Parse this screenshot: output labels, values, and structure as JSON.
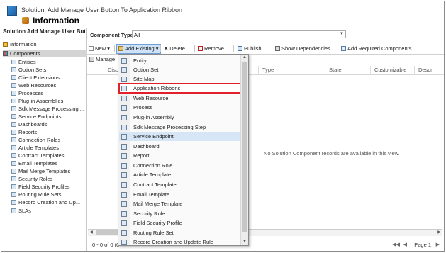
{
  "header": {
    "solution_label": "Solution: Add Manage User Button To Application Ribbon",
    "page_title": "Information"
  },
  "sidebar": {
    "title": "Solution Add Manage User Butto...",
    "items": [
      {
        "label": "Information",
        "icon": "info-icon"
      },
      {
        "label": "Components",
        "icon": "components-icon"
      },
      {
        "label": "Entities",
        "icon": "entities-icon"
      },
      {
        "label": "Option Sets",
        "icon": "option-sets-icon"
      },
      {
        "label": "Client Extensions",
        "icon": "client-extensions-icon"
      },
      {
        "label": "Web Resources",
        "icon": "web-resources-icon"
      },
      {
        "label": "Processes",
        "icon": "processes-icon"
      },
      {
        "label": "Plug-in Assemblies",
        "icon": "plugin-assemblies-icon"
      },
      {
        "label": "Sdk Message Processing ...",
        "icon": "sdk-message-icon"
      },
      {
        "label": "Service Endpoints",
        "icon": "service-endpoints-icon"
      },
      {
        "label": "Dashboards",
        "icon": "dashboards-icon"
      },
      {
        "label": "Reports",
        "icon": "reports-icon"
      },
      {
        "label": "Connection Roles",
        "icon": "connection-roles-icon"
      },
      {
        "label": "Article Templates",
        "icon": "article-templates-icon"
      },
      {
        "label": "Contract Templates",
        "icon": "contract-templates-icon"
      },
      {
        "label": "Email Templates",
        "icon": "email-templates-icon"
      },
      {
        "label": "Mail Merge Templates",
        "icon": "mail-merge-icon"
      },
      {
        "label": "Security Roles",
        "icon": "security-roles-icon"
      },
      {
        "label": "Field Security Profiles",
        "icon": "field-security-icon"
      },
      {
        "label": "Routing Rule Sets",
        "icon": "routing-rule-icon"
      },
      {
        "label": "Record Creation and Up...",
        "icon": "record-creation-icon"
      },
      {
        "label": "SLAs",
        "icon": "slas-icon"
      }
    ]
  },
  "main": {
    "component_type_label": "Component Type",
    "component_type_value": "All",
    "toolbar": {
      "new_label": "New",
      "add_existing_label": "Add Existing",
      "delete_label": "Delete",
      "remove_label": "Remove",
      "publish_label": "Publish",
      "show_dependencies_label": "Show Dependencies",
      "add_required_label": "Add Required Components"
    },
    "manage_label": "Manage",
    "columns": [
      "Disp",
      "Type",
      "State",
      "Customizable",
      "Descr"
    ],
    "empty_message": "No Solution Component records are available in this view.",
    "record_count": "0 - 0 of 0 (0",
    "page_label": "Page 1"
  },
  "dropdown_menu": {
    "items": [
      {
        "label": "Entity",
        "icon": "entity-icon"
      },
      {
        "label": "Option Set",
        "icon": "option-set-icon"
      },
      {
        "label": "Site Map",
        "icon": "site-map-icon"
      },
      {
        "label": "Application Ribbons",
        "icon": "application-ribbons-icon"
      },
      {
        "label": "Web Resource",
        "icon": "web-resource-icon"
      },
      {
        "label": "Process",
        "icon": "process-icon"
      },
      {
        "label": "Plug-in Assembly",
        "icon": "plugin-assembly-icon"
      },
      {
        "label": "Sdk Message Processing Step",
        "icon": "sdk-step-icon"
      },
      {
        "label": "Service Endpoint",
        "icon": "service-endpoint-icon"
      },
      {
        "label": "Dashboard",
        "icon": "dashboard-icon"
      },
      {
        "label": "Report",
        "icon": "report-icon"
      },
      {
        "label": "Connection Role",
        "icon": "connection-role-icon"
      },
      {
        "label": "Article Template",
        "icon": "article-template-icon"
      },
      {
        "label": "Contract Template",
        "icon": "contract-template-icon"
      },
      {
        "label": "Email Template",
        "icon": "email-template-icon"
      },
      {
        "label": "Mail Merge Template",
        "icon": "mail-merge-template-icon"
      },
      {
        "label": "Security Role",
        "icon": "security-role-icon"
      },
      {
        "label": "Field Security Profile",
        "icon": "field-security-profile-icon"
      },
      {
        "label": "Routing Rule Set",
        "icon": "routing-rule-set-icon"
      },
      {
        "label": "Record Creation and Update Rule",
        "icon": "record-creation-rule-icon"
      }
    ],
    "highlighted_item": "Application Ribbons",
    "hovered_item": "Service Endpoint"
  },
  "colors": {
    "highlight_border": "#e0202a",
    "hover_background": "#d6e6f6",
    "active_button": "#cfe2f7"
  }
}
